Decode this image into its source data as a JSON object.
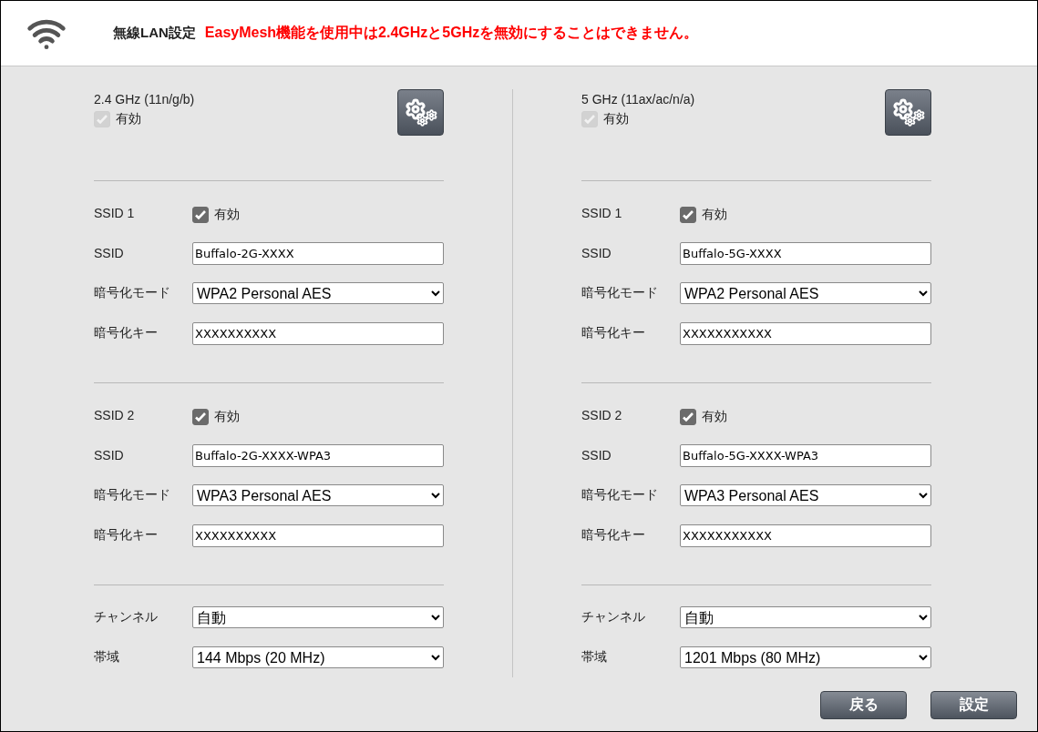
{
  "header": {
    "title": "無線LAN設定",
    "warning": "EasyMesh機能を使用中は2.4GHzと5GHzを無効にすることはできません。"
  },
  "bands": [
    {
      "title": "2.4 GHz (11n/g/b)",
      "enabled": {
        "label": "有効",
        "checked": true,
        "disabled": true
      },
      "ssids": [
        {
          "label": "SSID 1",
          "enabled": {
            "label": "有効",
            "checked": true
          },
          "fields": [
            {
              "kind": "text",
              "label": "SSID",
              "value": "Buffalo-2G-XXXX"
            },
            {
              "kind": "select",
              "label": "暗号化モード",
              "value": "WPA2 Personal AES"
            },
            {
              "kind": "text",
              "label": "暗号化キー",
              "value": "XXXXXXXXXX"
            }
          ]
        },
        {
          "label": "SSID 2",
          "enabled": {
            "label": "有効",
            "checked": true
          },
          "fields": [
            {
              "kind": "text",
              "label": "SSID",
              "value": "Buffalo-2G-XXXX-WPA3"
            },
            {
              "kind": "select",
              "label": "暗号化モード",
              "value": "WPA3 Personal AES"
            },
            {
              "kind": "text",
              "label": "暗号化キー",
              "value": "XXXXXXXXXX"
            }
          ]
        }
      ],
      "radio_fields": [
        {
          "kind": "select",
          "label": "チャンネル",
          "value": "自動"
        },
        {
          "kind": "select",
          "label": "帯域",
          "value": "144 Mbps (20 MHz)"
        }
      ]
    },
    {
      "title": "5 GHz (11ax/ac/n/a)",
      "enabled": {
        "label": "有効",
        "checked": true,
        "disabled": true
      },
      "ssids": [
        {
          "label": "SSID 1",
          "enabled": {
            "label": "有効",
            "checked": true
          },
          "fields": [
            {
              "kind": "text",
              "label": "SSID",
              "value": "Buffalo-5G-XXXX"
            },
            {
              "kind": "select",
              "label": "暗号化モード",
              "value": "WPA2 Personal AES"
            },
            {
              "kind": "text",
              "label": "暗号化キー",
              "value": "XXXXXXXXXXX"
            }
          ]
        },
        {
          "label": "SSID 2",
          "enabled": {
            "label": "有効",
            "checked": true
          },
          "fields": [
            {
              "kind": "text",
              "label": "SSID",
              "value": "Buffalo-5G-XXXX-WPA3"
            },
            {
              "kind": "select",
              "label": "暗号化モード",
              "value": "WPA3 Personal AES"
            },
            {
              "kind": "text",
              "label": "暗号化キー",
              "value": "XXXXXXXXXXX"
            }
          ]
        }
      ],
      "radio_fields": [
        {
          "kind": "select",
          "label": "チャンネル",
          "value": "自動"
        },
        {
          "kind": "select",
          "label": "帯域",
          "value": "1201 Mbps (80 MHz)"
        }
      ]
    }
  ],
  "buttons": [
    "戻る",
    "設定"
  ]
}
